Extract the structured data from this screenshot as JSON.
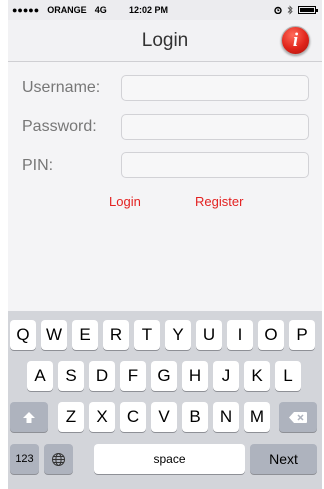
{
  "status_bar": {
    "signal": "●●●●●",
    "carrier": "ORANGE",
    "network": "4G",
    "time": "12:02 PM",
    "icons": [
      "alarm-icon",
      "bluetooth-icon",
      "battery-icon"
    ]
  },
  "nav": {
    "title": "Login",
    "info_glyph": "i"
  },
  "form": {
    "username_label": "Username:",
    "username_value": "",
    "password_label": "Password:",
    "password_value": "",
    "pin_label": "PIN:",
    "pin_value": ""
  },
  "links": {
    "login": "Login",
    "register": "Register"
  },
  "colors": {
    "link": "#e32222",
    "info_button": "#e0241a",
    "keyboard_bg": "#d3d5da"
  },
  "keyboard": {
    "row1": [
      "Q",
      "W",
      "E",
      "R",
      "T",
      "Y",
      "U",
      "I",
      "O",
      "P"
    ],
    "row2": [
      "A",
      "S",
      "D",
      "F",
      "G",
      "H",
      "J",
      "K",
      "L"
    ],
    "row3": [
      "Z",
      "X",
      "C",
      "V",
      "B",
      "N",
      "M"
    ],
    "shift_icon": "shift-icon",
    "delete_icon": "delete-icon",
    "numbers": "123",
    "globe_icon": "globe-icon",
    "space": "space",
    "next": "Next"
  }
}
